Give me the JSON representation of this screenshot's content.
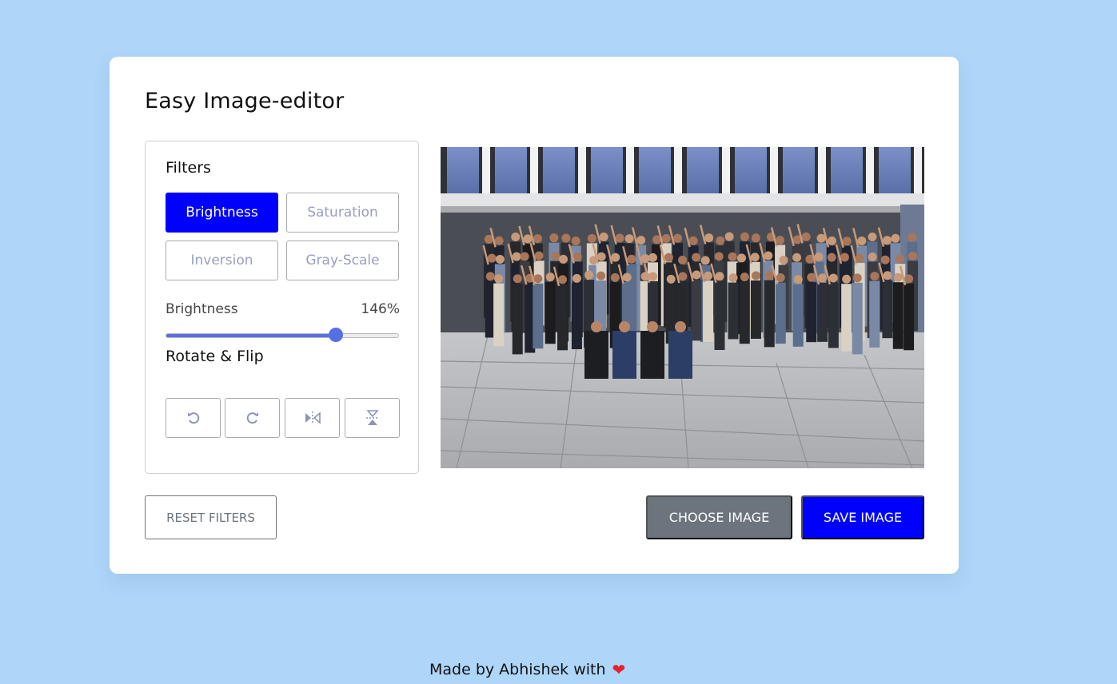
{
  "app": {
    "title": "Easy Image-editor"
  },
  "filters": {
    "heading": "Filters",
    "options": [
      {
        "label": "Brightness",
        "active": true
      },
      {
        "label": "Saturation",
        "active": false
      },
      {
        "label": "Inversion",
        "active": false
      },
      {
        "label": "Gray-Scale",
        "active": false
      }
    ]
  },
  "slider": {
    "label": "Brightness",
    "value_text": "146%",
    "value": 146,
    "min": 0,
    "max": 200
  },
  "rotate_flip": {
    "heading": "Rotate & Flip",
    "buttons": [
      {
        "icon": "rotate-left-icon"
      },
      {
        "icon": "rotate-right-icon"
      },
      {
        "icon": "flip-horizontal-icon"
      },
      {
        "icon": "flip-vertical-icon"
      }
    ]
  },
  "preview": {
    "subject": "group-photo"
  },
  "actions": {
    "reset_label": "RESET FILTERS",
    "choose_label": "CHOOSE IMAGE",
    "save_label": "SAVE IMAGE"
  },
  "footer": {
    "text": "Made by Abhishek with",
    "icon": "heart-icon"
  },
  "colors": {
    "background": "#aed6f9",
    "accent": "#0000ff",
    "secondary": "#6c757d",
    "slider": "#5670e4",
    "heart": "#e8212e"
  }
}
